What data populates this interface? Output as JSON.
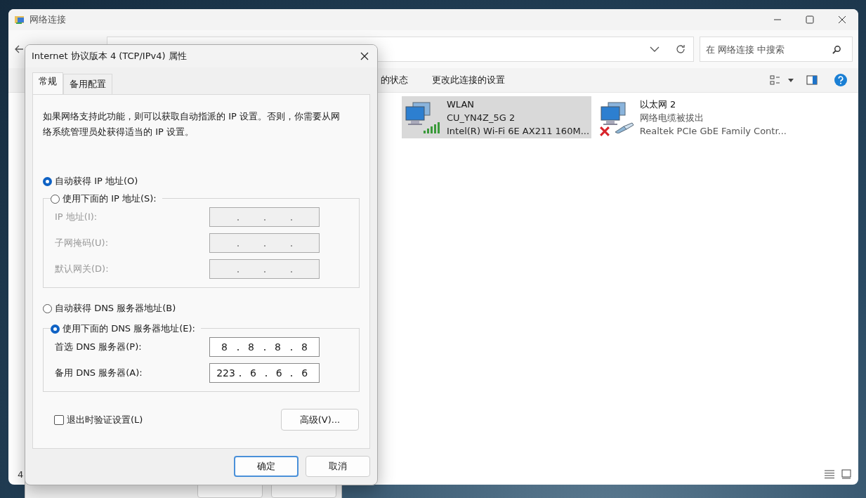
{
  "explorer": {
    "title": "网络连接",
    "search": {
      "placeholder": "在 网络连接 中搜索"
    },
    "commands": [
      {
        "label": "的状态"
      },
      {
        "label": "更改此连接的设置"
      }
    ],
    "connections": [
      {
        "kind": "wifi",
        "name": "WLAN",
        "detail": "CU_YN4Z_5G 2",
        "adapter": "Intel(R) Wi-Fi 6E AX211 160M...",
        "selected": true
      },
      {
        "kind": "ethernet",
        "name": "以太网 2",
        "detail": "网络电缆被拔出",
        "adapter": "Realtek PCIe GbE Family Contr...",
        "selected": false
      }
    ],
    "status_count": "4"
  },
  "dialog": {
    "title": "Internet 协议版本 4 (TCP/IPv4) 属性",
    "tabs": [
      {
        "label": "常规",
        "selected": true
      },
      {
        "label": "备用配置",
        "selected": false
      }
    ],
    "description": "如果网络支持此功能，则可以获取自动指派的 IP 设置。否则，你需要从网络系统管理员处获得适当的 IP 设置。",
    "ip_options": [
      {
        "label": "自动获得 IP 地址(O)",
        "selected": true
      },
      {
        "label": "使用下面的 IP 地址(S):",
        "selected": false
      }
    ],
    "ip_fields": [
      {
        "label": "IP 地址(I):",
        "disabled": true
      },
      {
        "label": "子网掩码(U):",
        "disabled": true
      },
      {
        "label": "默认网关(D):",
        "disabled": true
      }
    ],
    "dns_options": [
      {
        "label": "自动获得 DNS 服务器地址(B)",
        "selected": false
      },
      {
        "label": "使用下面的 DNS 服务器地址(E):",
        "selected": true
      }
    ],
    "dns_fields": [
      {
        "label": "首选 DNS 服务器(P):",
        "disabled": false,
        "octets": [
          "8",
          "8",
          "8",
          "8"
        ]
      },
      {
        "label": "备用 DNS 服务器(A):",
        "disabled": false,
        "octets": [
          "223",
          "6",
          "6",
          "6"
        ]
      }
    ],
    "validate": {
      "label": "退出时验证设置(L)",
      "checked": false
    },
    "advanced": "高级(V)...",
    "buttons": [
      {
        "label": "确定",
        "default": true
      },
      {
        "label": "取消",
        "default": false
      }
    ]
  }
}
